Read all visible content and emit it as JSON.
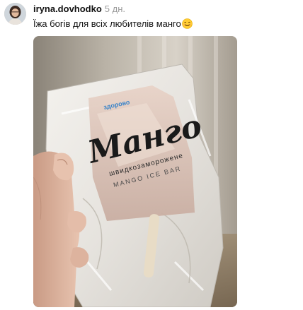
{
  "post": {
    "author": {
      "username": "iryna.dovhodko",
      "avatar_icon": "user-avatar-icon"
    },
    "time_ago": "5 дн.",
    "caption": "Їжа богів для всіх любителів манго",
    "caption_emoji": "smiling-face-emoji",
    "photo": {
      "package_brand": "Манго",
      "package_subtitle": "швидкозаморожене",
      "package_english": "MANGO ICE BAR",
      "package_logo_text": "здорово"
    }
  },
  "colors": {
    "username": "#111111",
    "timestamp": "#9a9a9a",
    "caption": "#111111",
    "background": "#ffffff"
  }
}
